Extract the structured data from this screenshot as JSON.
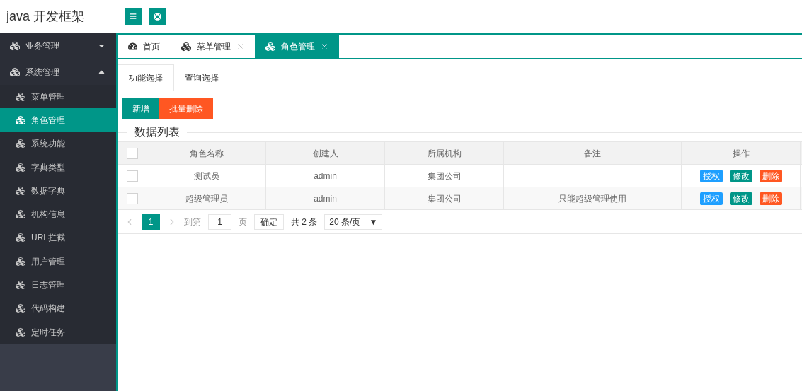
{
  "header": {
    "title": "java 开发框架"
  },
  "sidebar": {
    "groups": [
      {
        "label": "业务管理",
        "expanded": false
      },
      {
        "label": "系统管理",
        "expanded": true,
        "children": [
          {
            "label": "菜单管理",
            "selected": false
          },
          {
            "label": "角色管理",
            "selected": true
          },
          {
            "label": "系统功能",
            "selected": false
          },
          {
            "label": "字典类型",
            "selected": false
          },
          {
            "label": "数据字典",
            "selected": false
          },
          {
            "label": "机构信息",
            "selected": false
          },
          {
            "label": "URL拦截",
            "selected": false
          },
          {
            "label": "用户管理",
            "selected": false
          },
          {
            "label": "日志管理",
            "selected": false
          },
          {
            "label": "代码构建",
            "selected": false
          },
          {
            "label": "定时任务",
            "selected": false
          }
        ]
      }
    ]
  },
  "page_tabs": [
    {
      "label": "首页",
      "kind": "home",
      "closable": false,
      "selected": false
    },
    {
      "label": "菜单管理",
      "kind": "page",
      "closable": true,
      "selected": false
    },
    {
      "label": "角色管理",
      "kind": "page",
      "closable": true,
      "selected": true
    }
  ],
  "sub_tabs": [
    {
      "label": "功能选择",
      "selected": true
    },
    {
      "label": "查询选择",
      "selected": false
    }
  ],
  "toolbar": [
    {
      "label": "新增",
      "kind": "primary"
    },
    {
      "label": "批量删除",
      "kind": "danger"
    }
  ],
  "section_title": "数据列表",
  "table": {
    "header_checked": false,
    "columns": [
      "角色名称",
      "创建人",
      "所属机构",
      "备注",
      "操作"
    ],
    "rows": [
      {
        "checked": false,
        "cells": [
          "测试员",
          "admin",
          "集团公司",
          ""
        ],
        "actions": [
          {
            "label": "授权",
            "kind": "info"
          },
          {
            "label": "修改",
            "kind": "primary"
          },
          {
            "label": "删除",
            "kind": "danger"
          }
        ]
      },
      {
        "checked": false,
        "cells": [
          "超级管理员",
          "admin",
          "集团公司",
          "只能超级管理使用"
        ],
        "actions": [
          {
            "label": "授权",
            "kind": "info"
          },
          {
            "label": "修改",
            "kind": "primary"
          },
          {
            "label": "删除",
            "kind": "danger"
          }
        ]
      }
    ]
  },
  "pagination": {
    "pages": [
      {
        "label": "1",
        "selected": true
      }
    ],
    "goto_label": "到第",
    "goto_value": "1",
    "page_unit": "页",
    "confirm": "确定",
    "total": "共 2 条",
    "page_size": "20 条/页",
    "page_size_caret": "▼"
  }
}
